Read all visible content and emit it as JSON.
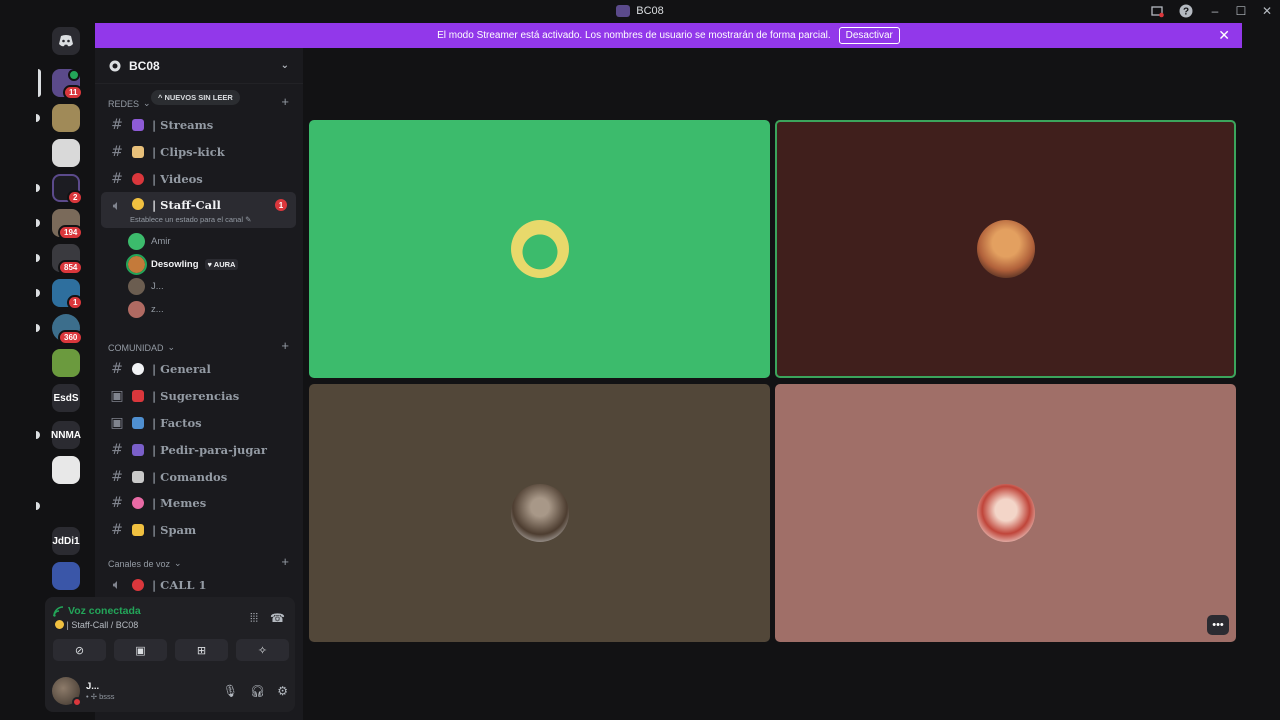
{
  "window": {
    "title": "BC08"
  },
  "titlebar_icons": [
    "screen-share-icon",
    "help-icon",
    "minimize-icon",
    "maximize-icon",
    "close-icon"
  ],
  "server_rail": {
    "items": [
      {
        "name": "discord-home",
        "badge": ""
      },
      {
        "name": "server-1",
        "badge": "11"
      },
      {
        "name": "server-2",
        "badge": ""
      },
      {
        "name": "server-3",
        "badge": ""
      },
      {
        "name": "server-4",
        "badge": "2"
      },
      {
        "name": "server-5",
        "badge": "194"
      },
      {
        "name": "server-6",
        "badge": "854"
      },
      {
        "name": "server-7",
        "badge": "1"
      },
      {
        "name": "server-8",
        "badge": "360"
      },
      {
        "name": "server-9",
        "badge": ""
      },
      {
        "name": "server-esds",
        "label": "EsdS",
        "badge": ""
      },
      {
        "name": "server-nnma",
        "label": "NNMA",
        "badge": ""
      },
      {
        "name": "server-12",
        "badge": ""
      },
      {
        "name": "server-13",
        "badge": ""
      },
      {
        "name": "server-jddi",
        "label": "JdDi1",
        "badge": ""
      },
      {
        "name": "server-15",
        "badge": ""
      }
    ]
  },
  "streamer_banner": {
    "text": "El modo Streamer está activado. Los nombres de usuario se mostrarán de forma parcial.",
    "button": "Desactivar"
  },
  "server": {
    "name": "BC08"
  },
  "categories": {
    "redes": "REDES",
    "unread_pill": "NUEVOS SIN LEER",
    "comunidad": "COMUNIDAD",
    "voz": "Canales de voz"
  },
  "channels": {
    "streams": "| Streams",
    "clips": "| Clips-kick",
    "videos": "| Videos",
    "staff_call": "| Staff-Call",
    "staff_call_status": "Establece un estado para el canal",
    "staff_call_badge": "1",
    "general": "| General",
    "sugerencias": "| Sugerencias",
    "factos": "| Factos",
    "pedir": "| Pedir-para-jugar",
    "comandos": "| Comandos",
    "memes": "| Memes",
    "spam": "| Spam",
    "call1": "| CALL 1"
  },
  "voice_members": [
    {
      "name": "Amir"
    },
    {
      "name": "Desowling",
      "tag": "AURA"
    },
    {
      "name": "J..."
    },
    {
      "name": "z..."
    }
  ],
  "voice_panel": {
    "status": "Voz conectada",
    "channel": "| Staff-Call / BC08",
    "user_name": "J...",
    "user_status": "bsss"
  },
  "tiles": [
    {
      "name": "tile-1",
      "bg": "#3cbb6c",
      "speaking": false
    },
    {
      "name": "tile-2",
      "bg": "#401f1c",
      "speaking": true
    },
    {
      "name": "tile-3",
      "bg": "#524739",
      "speaking": false
    },
    {
      "name": "tile-4",
      "bg": "#a06f68",
      "speaking": false
    }
  ],
  "colors": {
    "accent_purple": "#9238ea",
    "voice_green": "#23a559",
    "badge_red": "#da373c"
  }
}
